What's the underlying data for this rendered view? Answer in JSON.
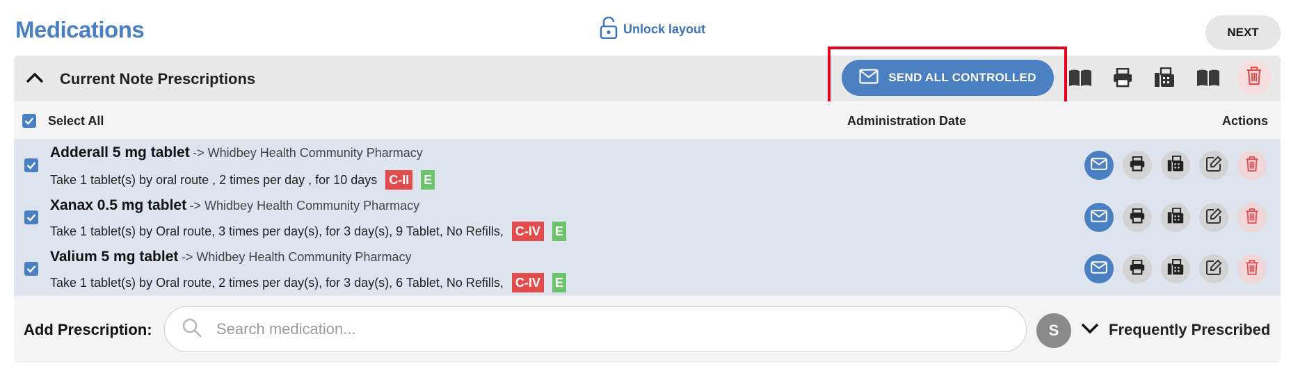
{
  "page": {
    "title": "Medications",
    "unlock_label": "Unlock layout",
    "next_label": "NEXT"
  },
  "section": {
    "title": "Current Note Prescriptions",
    "send_all_label": "SEND ALL CONTROLLED"
  },
  "columns": {
    "select_all": "Select All",
    "admin_date": "Administration Date",
    "actions": "Actions"
  },
  "prescriptions": [
    {
      "name": "Adderall 5 mg tablet",
      "pharmacy": "-> Whidbey Health Community Pharmacy",
      "sig": "Take 1 tablet(s) by oral route , 2 times per day , for 10 days",
      "schedule": "C-II",
      "e_badge": "E",
      "checked": true
    },
    {
      "name": "Xanax 0.5 mg tablet",
      "pharmacy": "-> Whidbey Health Community Pharmacy",
      "sig": "Take 1 tablet(s) by Oral route, 3 times per day(s), for 3 day(s), 9 Tablet, No Refills,",
      "schedule": "C-IV",
      "e_badge": "E",
      "checked": true
    },
    {
      "name": "Valium 5 mg tablet",
      "pharmacy": "-> Whidbey Health Community Pharmacy",
      "sig": "Take 1 tablet(s) by Oral route, 2 times per day(s), for 3 day(s), 6 Tablet, No Refills,",
      "schedule": "C-IV",
      "e_badge": "E",
      "checked": true
    }
  ],
  "add": {
    "label": "Add Prescription:",
    "placeholder": "Search medication...",
    "avatar_letter": "S",
    "frequent_label": "Frequently Prescribed"
  },
  "icons": {
    "lock": "unlock-icon",
    "chevron_up": "chevron-up-icon",
    "mail": "mail-icon",
    "book": "book-icon",
    "print": "printer-icon",
    "fax": "fax-icon",
    "edit": "edit-icon",
    "trash": "trash-icon",
    "search": "search-icon",
    "chevron_down": "chevron-down-icon"
  },
  "colors": {
    "accent": "#4a7fc1",
    "danger": "#e24c4c",
    "epcs": "#6cc46a",
    "highlight_box": "#e3001b"
  }
}
